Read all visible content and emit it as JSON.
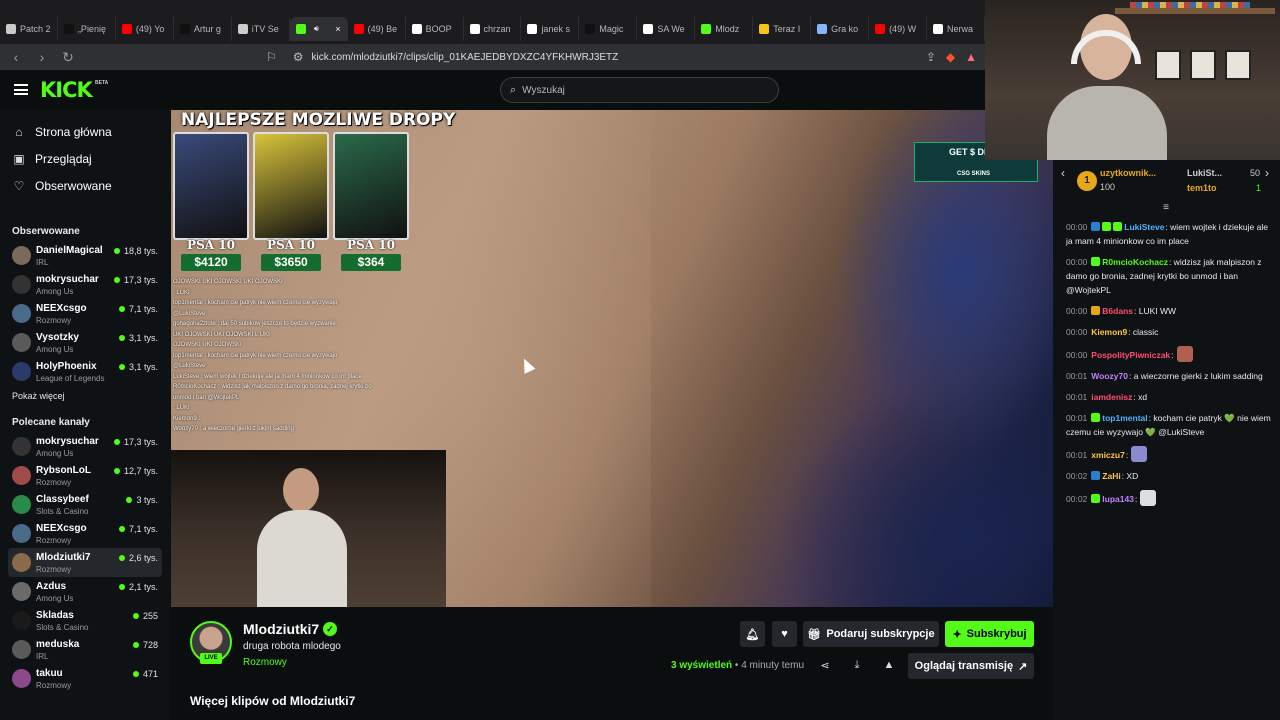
{
  "browser": {
    "tabs": [
      {
        "label": "Patch 2",
        "color": "#c9c9c9"
      },
      {
        "label": "„Pienię",
        "color": "#111111"
      },
      {
        "label": "(49) Yo",
        "color": "#ff0000"
      },
      {
        "label": "Artur g",
        "color": "#111111"
      },
      {
        "label": "iTV Se",
        "color": "#cccccc"
      },
      {
        "label": "",
        "color": "#53fc18"
      },
      {
        "label": "(49) Be",
        "color": "#ff0000"
      },
      {
        "label": "BOOP",
        "color": "#ffffff"
      },
      {
        "label": "chrzan",
        "color": "#ffffff"
      },
      {
        "label": "janek s",
        "color": "#ffffff"
      },
      {
        "label": "Magic",
        "color": "#111111"
      },
      {
        "label": "SA We",
        "color": "#ffffff"
      },
      {
        "label": "Mlodz",
        "color": "#53fc18"
      },
      {
        "label": "Teraz I",
        "color": "#f5c518"
      },
      {
        "label": "Gra ko",
        "color": "#8ab4f8"
      },
      {
        "label": "(49) W",
        "color": "#ff0000"
      },
      {
        "label": "Nerwa",
        "color": "#ffffff"
      }
    ],
    "url": "kick.com/mlodziutki7/clips/clip_01KAEJEDBYDXZC4YFKHWRJ3ETZ"
  },
  "header": {
    "logo": "KICK",
    "logo_badge": "BETA",
    "search_placeholder": "Wyszukaj"
  },
  "sidebar": {
    "nav": [
      {
        "label": "Strona główna",
        "icon": "home-icon"
      },
      {
        "label": "Przeglądaj",
        "icon": "browse-icon"
      },
      {
        "label": "Obserwowane",
        "icon": "heart-icon"
      }
    ],
    "followed_title": "Obserwowane",
    "followed": [
      {
        "name": "DanielMagical",
        "category": "IRL",
        "viewers": "18,8 tys.",
        "color": "#7a6a5a"
      },
      {
        "name": "mokrysuchar",
        "category": "Among Us",
        "viewers": "17,3 tys.",
        "color": "#333333"
      },
      {
        "name": "NEEXcsgo",
        "category": "Rozmowy",
        "viewers": "7,1 tys.",
        "color": "#4a6a8a"
      },
      {
        "name": "Vysotzky",
        "category": "Among Us",
        "viewers": "3,1 tys.",
        "color": "#5a5a5a"
      },
      {
        "name": "HolyPhoenix",
        "category": "League of Legends",
        "viewers": "3,1 tys.",
        "color": "#2a3a6a"
      }
    ],
    "show_more": "Pokaż więcej",
    "recommended_title": "Polecane kanały",
    "recommended": [
      {
        "name": "mokrysuchar",
        "category": "Among Us",
        "viewers": "17,3 tys.",
        "color": "#333333"
      },
      {
        "name": "RybsonLoL",
        "category": "Rozmowy",
        "viewers": "12,7 tys.",
        "color": "#a04a4a"
      },
      {
        "name": "Classybeef",
        "category": "Slots & Casino",
        "viewers": "3 tys.",
        "color": "#2a8a4a"
      },
      {
        "name": "NEEXcsgo",
        "category": "Rozmowy",
        "viewers": "7,1 tys.",
        "color": "#4a6a8a"
      },
      {
        "name": "Mlodziutki7",
        "category": "Rozmowy",
        "viewers": "2,6 tys.",
        "color": "#8a6a4a",
        "active": true
      },
      {
        "name": "Azdus",
        "category": "Among Us",
        "viewers": "2,1 tys.",
        "color": "#6a6a6a"
      },
      {
        "name": "Skladas",
        "category": "Slots & Casino",
        "viewers": "255",
        "color": "#1a1a1a"
      },
      {
        "name": "meduska",
        "category": "IRL",
        "viewers": "728",
        "color": "#5a5a5a"
      },
      {
        "name": "takuu",
        "category": "Rozmowy",
        "viewers": "471",
        "color": "#8a4a8a"
      }
    ]
  },
  "video": {
    "promo_title": "NAJLEPSZE MOZLIWE DROPY",
    "cards": [
      {
        "grade": "PSA 10",
        "price": "$4120",
        "color": "#3a4a7a"
      },
      {
        "grade": "PSA 10",
        "price": "$3650",
        "color": "#d8c43a"
      },
      {
        "grade": "PSA 10",
        "price": "$364",
        "color": "#2a6a4a"
      }
    ],
    "overlay_chat": [
      "OJOWSKI  UKI  OJOWSKI  UKI  OJOWSKI",
      ": LUKI",
      "top1mental : kocham cie patryk  nie wiem czemu cie wyzywajo",
      "@LukiSteve",
      "gohagoha2zlote : daj 50 subikow jeszcze to będzie wyzwanie",
      "UKI  OJOWSKI  UKI  OJOWSKI  L UKI",
      "OJOWSKI  UKI  OJOWSKI",
      "top1mental : kocham cie patryk  nie wiem czemu cie wyzywajo",
      "@LukiSteve",
      "LukiSteve : wiem wojtek i dziekuje ale ja mam 4 minionkow co im place",
      "R0mcioKochacz : widzisz jak malpiszon z damo go bronia, zadnej krytki bo",
      "unmod i ban @WojtekPL",
      ": LUKI",
      "Kiemon9 :",
      "Woozy70 : a wieczorne gierki z lukim sadding"
    ],
    "sponsor_text": "GET $ DEPOS",
    "sponsor_sub": "CSG SKINS"
  },
  "chat": {
    "top_gifters": [
      {
        "rank": "1",
        "name": "uzytkownik...",
        "count": "100",
        "color": "#e6a817"
      },
      {
        "name": "LukiSt...",
        "count": "50",
        "color": "#cccccc"
      },
      {
        "name": "tem1to",
        "count": "1",
        "color": "#e6a817"
      }
    ],
    "messages": [
      {
        "time": "00:00",
        "user": "LukiSteve",
        "color": "#4fb3ff",
        "badges": [
          "#2a7fcf",
          "#53fc18",
          "#53fc18"
        ],
        "text": ": wiem wojtek i dziekuje ale ja mam 4 minionkow co im place"
      },
      {
        "time": "00:00",
        "user": "R0mcioKochacz",
        "color": "#53fc18",
        "badges": [
          "#53fc18"
        ],
        "text": ": widzisz jak malpiszon z damo go bronia, zadnej krytki bo unmod i ban @WojtekPL"
      },
      {
        "time": "00:00",
        "user": "B6dans",
        "color": "#ff4d6d",
        "badges": [
          "#e6a817"
        ],
        "text": ": LUKI WW"
      },
      {
        "time": "00:00",
        "user": "Kiemon9",
        "color": "#ffc83d",
        "badges": [],
        "text": ": classic"
      },
      {
        "time": "00:00",
        "user": "PospolityPiwniczak",
        "color": "#ff4d6d",
        "badges": [],
        "text": ":",
        "emote": "#b06050"
      },
      {
        "time": "00:01",
        "user": "Woozy70",
        "color": "#c77dff",
        "badges": [],
        "text": ": a wieczorne gierki z lukim sadding"
      },
      {
        "time": "00:01",
        "user": "iamdenisz",
        "color": "#ff4d6d",
        "badges": [],
        "text": ": xd"
      },
      {
        "time": "00:01",
        "user": "top1mental",
        "color": "#4fb3ff",
        "badges": [
          "#53fc18"
        ],
        "text": ": kocham cie patryk 💚 nie wiem czemu cie wyzywajo 💚 @LukiSteve"
      },
      {
        "time": "00:01",
        "user": "xmiczu7",
        "color": "#ffc83d",
        "badges": [],
        "text": ":",
        "emote": "#8a8ad0"
      },
      {
        "time": "00:02",
        "user": "ZaHi",
        "color": "#ffc83d",
        "badges": [
          "#2a7fcf"
        ],
        "text": ": XD"
      },
      {
        "time": "00:02",
        "user": "lupa143",
        "color": "#c77dff",
        "badges": [
          "#53fc18"
        ],
        "text": ":",
        "emote": "#dddddd"
      }
    ]
  },
  "clip": {
    "channel": "Mlodziutki7",
    "live_label": "LIVE",
    "title": "druga robota mlodego",
    "category": "Rozmowy",
    "gift_sub_label": "Podaruj subskrypcje",
    "subscribe_label": "Subskrybuj",
    "views_count": "3",
    "views_label": " wyświetleń",
    "time_ago": " • 4 minuty temu",
    "watch_label": "Oglądaj transmisję",
    "more_clips": "Więcej klipów od Mlodziutki7"
  }
}
